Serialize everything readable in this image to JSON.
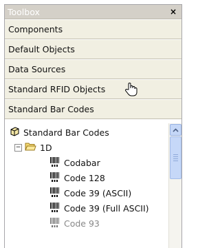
{
  "toolbox": {
    "title": "Toolbox",
    "close_glyph": "×",
    "sections": [
      {
        "label": "Components"
      },
      {
        "label": "Default Objects"
      },
      {
        "label": "Data Sources"
      },
      {
        "label": "Standard RFID Objects"
      },
      {
        "label": "Standard Bar Codes"
      }
    ]
  },
  "tree": {
    "root_label": "Standard Bar Codes",
    "group": {
      "label": "1D",
      "expander": "−"
    },
    "items": [
      {
        "label": "Codabar"
      },
      {
        "label": "Code 128"
      },
      {
        "label": "Code 39 (ASCII)"
      },
      {
        "label": "Code 39 (Full ASCII)"
      },
      {
        "label": "Code 93"
      }
    ]
  },
  "colors": {
    "title_bg": "#d4d0c8",
    "section_bg": "#f1efe2",
    "scroll_accent": "#c6d8f8"
  }
}
